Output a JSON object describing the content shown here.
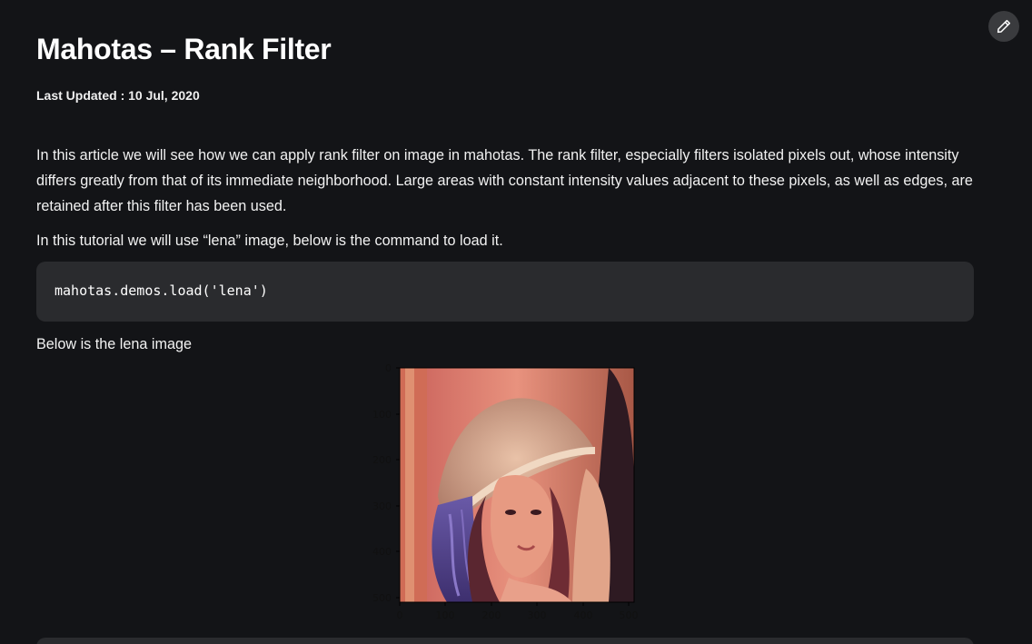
{
  "article": {
    "title": "Mahotas – Rank Filter",
    "last_updated": "Last Updated : 10 Jul, 2020",
    "intro": "In this article we will see how we can apply rank filter on image in mahotas. The rank filter, especially filters isolated pixels out, whose intensity differs greatly from that of its immediate neighborhood. Large areas with constant intensity values adjacent to these pixels, as well as edges, are retained after this filter has been used.",
    "tutorial_line": "In this tutorial we will use “lena” image, below is the command to load it.",
    "code": "mahotas.demos.load('lena')",
    "image_caption": "Below is the lena image"
  },
  "figure": {
    "y_ticks": [
      "0",
      "100",
      "200",
      "300",
      "400",
      "500"
    ],
    "x_ticks": [
      "0",
      "100",
      "200",
      "300",
      "400",
      "500"
    ]
  },
  "icons": {
    "edit": "pencil-icon"
  },
  "colors": {
    "background": "#131417",
    "code_background": "#2a2b2e",
    "edit_button": "#3a3b3e"
  }
}
